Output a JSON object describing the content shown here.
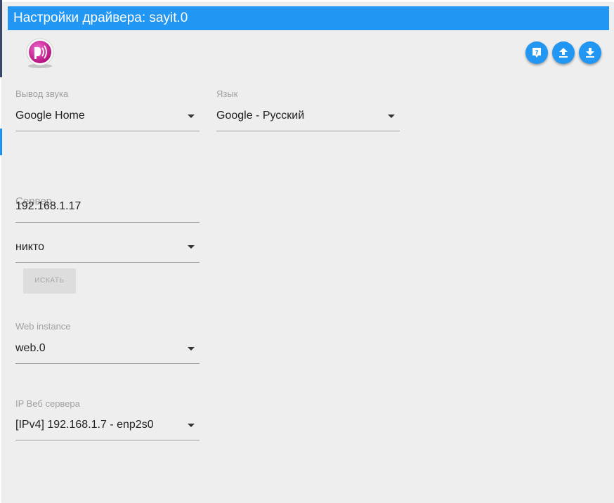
{
  "dialog": {
    "title": "Настройки драйвера: sayit.0"
  },
  "toolbar": {
    "help_icon": "help-icon",
    "upload_icon": "upload-icon",
    "download_icon": "download-icon"
  },
  "logo": {
    "icon": "sayit-logo-icon"
  },
  "fields": {
    "sound_output": {
      "label": "Вывод звука",
      "value": "Google Home"
    },
    "language": {
      "label": "Язык",
      "value": "Google - Русский"
    },
    "server": {
      "label": "Сервер",
      "value": "192.168.1.17"
    },
    "device": {
      "value": "никто"
    },
    "web_instance": {
      "label": "Web instance",
      "value": "web.0"
    },
    "web_server_ip": {
      "label": "IP Веб сервера",
      "value": "[IPv4] 192.168.1.7 - enp2s0"
    }
  },
  "buttons": {
    "search_label": "ИСКАТЬ"
  },
  "colors": {
    "accent": "#2196f3",
    "background": "#eeeeee",
    "logo": "#d81b9c"
  }
}
